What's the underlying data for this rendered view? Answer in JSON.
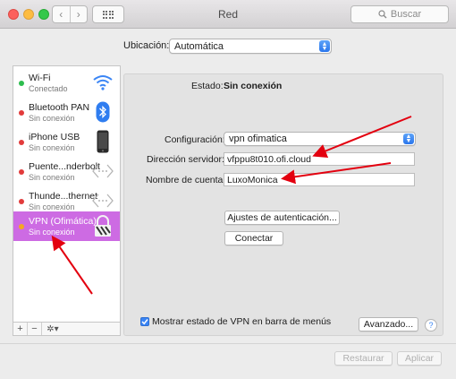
{
  "window": {
    "title": "Red"
  },
  "search": {
    "placeholder": "Buscar"
  },
  "location": {
    "label": "Ubicación:",
    "value": "Automática"
  },
  "sidebar": {
    "items": [
      {
        "name": "Wi-Fi",
        "status": "Conectado",
        "dot": "#2dbd4e",
        "icon": "wifi-icon"
      },
      {
        "name": "Bluetooth PAN",
        "status": "Sin conexión",
        "dot": "#e23b3b",
        "icon": "bluetooth-icon"
      },
      {
        "name": "iPhone USB",
        "status": "Sin conexión",
        "dot": "#e23b3b",
        "icon": "iphone-icon"
      },
      {
        "name": "Puente...nderbolt",
        "status": "Sin conexión",
        "dot": "#e23b3b",
        "icon": "thunderbolt-bridge-icon"
      },
      {
        "name": "Thunde...thernet",
        "status": "Sin conexión",
        "dot": "#e23b3b",
        "icon": "thunderbolt-ethernet-icon"
      },
      {
        "name": "VPN (Ofimática)",
        "status": "Sin conexión",
        "dot": "#f5a623",
        "icon": "vpn-lock-icon",
        "selected": true
      }
    ],
    "footer": {
      "add": "+",
      "remove": "−",
      "gear": "✲▾"
    }
  },
  "detail": {
    "status_label": "Estado:",
    "status_value": "Sin conexión",
    "config_label": "Configuración:",
    "config_value": "vpn ofimatica",
    "server_label": "Dirección servidor:",
    "server_value": "vfppu8t010.ofi.cloud",
    "account_label": "Nombre de cuenta:",
    "account_value": "LuxoMonica",
    "auth_button": "Ajustes de autenticación...",
    "connect_button": "Conectar",
    "show_vpn_label": "Mostrar estado de VPN en barra de menús",
    "advanced_button": "Avanzado...",
    "help": "?"
  },
  "footer": {
    "revert": "Restaurar",
    "apply": "Aplicar"
  },
  "colors": {
    "selected": "#cd6be3",
    "annotation_arrows": "#e3000f"
  }
}
